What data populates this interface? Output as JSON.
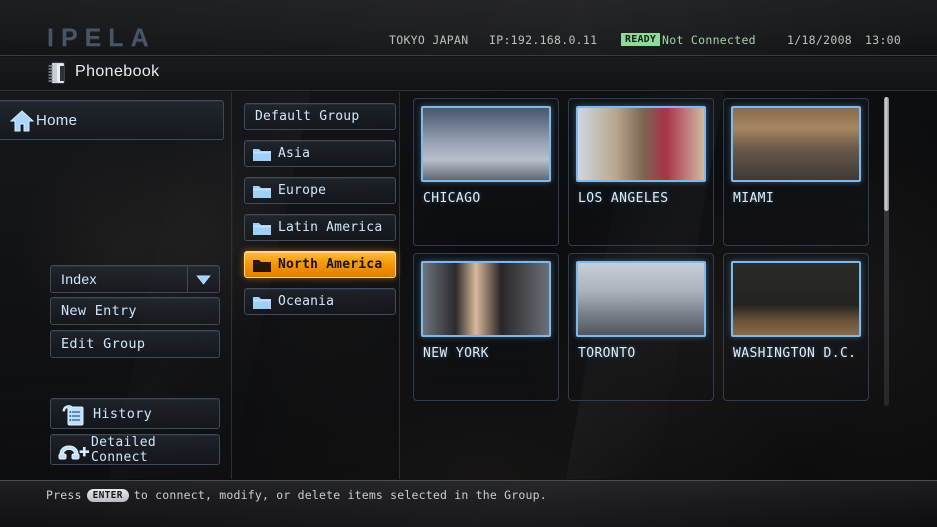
{
  "header": {
    "logo": "IPELA",
    "status": {
      "location": "TOKYO JAPAN",
      "ip": "IP:192.168.0.11",
      "ready_badge": "READY",
      "connection": "Not Connected",
      "date": "1/18/2008",
      "time": "13:00"
    },
    "page_title": "Phonebook",
    "page_icon": "phonebook-icon"
  },
  "colors": {
    "accent_selected": "#f79808",
    "accent_blue": "#7fb8ea",
    "ready_green": "#8fd99a",
    "text_primary": "#d3e7fb",
    "panel_bg": "#0b0c0e"
  },
  "sidebar": {
    "home": {
      "label": "Home",
      "icon": "home-icon"
    },
    "index": {
      "label": "Index",
      "icon": "chevron-down-icon"
    },
    "new_entry": {
      "label": "New Entry"
    },
    "edit_group": {
      "label": "Edit Group"
    },
    "history": {
      "label": "History",
      "icon": "history-icon"
    },
    "detailed_connect": {
      "label": "Detailed Connect",
      "icon": "phone-plus-icon"
    }
  },
  "groups": [
    {
      "label": "Default Group",
      "has_folder": false,
      "selected": false
    },
    {
      "label": "Asia",
      "has_folder": true,
      "selected": false
    },
    {
      "label": "Europe",
      "has_folder": true,
      "selected": false
    },
    {
      "label": "Latin America",
      "has_folder": true,
      "selected": false
    },
    {
      "label": "North America",
      "has_folder": true,
      "selected": true
    },
    {
      "label": "Oceania",
      "has_folder": true,
      "selected": false
    }
  ],
  "entries": [
    {
      "label": "CHICAGO"
    },
    {
      "label": "LOS ANGELES"
    },
    {
      "label": "MIAMI"
    },
    {
      "label": "NEW YORK"
    },
    {
      "label": "TORONTO"
    },
    {
      "label": "WASHINGTON D.C."
    }
  ],
  "footer": {
    "hint_before": "Press",
    "hint_key": "ENTER",
    "hint_after": "to connect, modify, or delete items selected in the Group."
  }
}
